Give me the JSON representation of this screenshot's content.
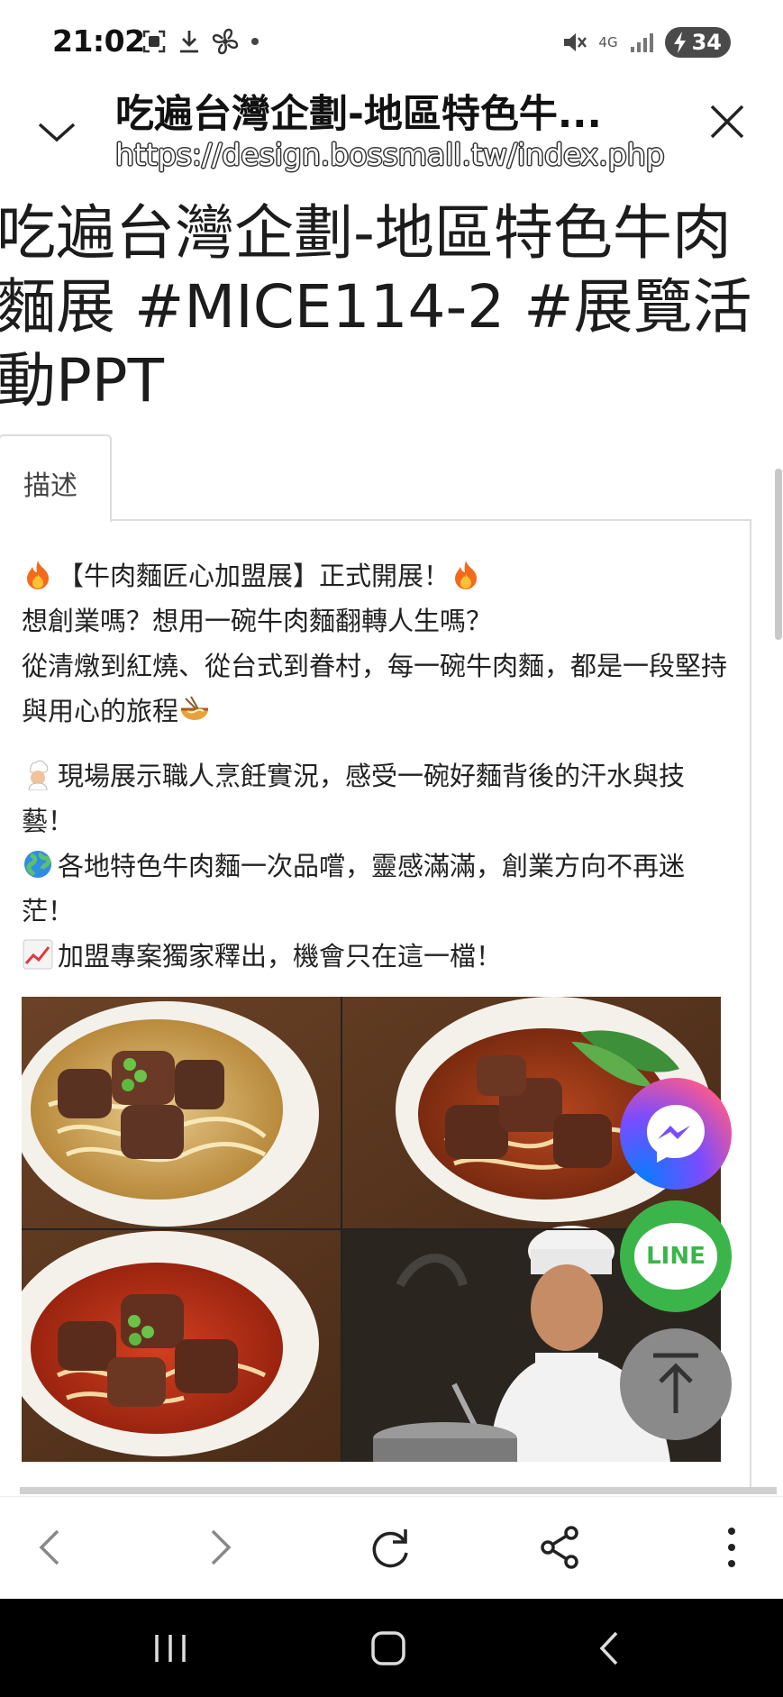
{
  "status_bar": {
    "time": "21:02",
    "network": "4G",
    "battery": "34"
  },
  "header": {
    "title": "吃遍台灣企劃-地區特色牛...",
    "url": "https://design.bossmall.tw/index.php"
  },
  "page": {
    "title": "吃遍台灣企劃-地區特色牛肉麵展 #MICE114-2 #展覽活動PPT",
    "tab_label": "描述",
    "paragraph1": [
      "【牛肉麵匠心加盟展】正式開展！",
      "想創業嗎？想用一碗牛肉麵翻轉人生嗎？",
      "從清燉到紅燒、從台式到眷村，每一碗牛肉麵，都是一段堅持與用心的旅程"
    ],
    "paragraph2": [
      "現場展示職人烹飪實況，感受一碗好麵背後的汗水與技藝！",
      "各地特色牛肉麵一次品嚐，靈感滿滿，創業方向不再迷茫！",
      "加盟專案獨家釋出，機會只在這一檔！"
    ]
  },
  "floating": {
    "line_label": "LINE"
  },
  "icons": {
    "status": [
      "screenshot-icon",
      "download-icon",
      "fan-icon",
      "dot-icon",
      "mute-icon",
      "signal-icon",
      "battery-icon"
    ],
    "header": [
      "chevron-down-icon",
      "close-icon"
    ],
    "toolbar": [
      "back-icon",
      "forward-icon",
      "reload-icon",
      "share-icon",
      "more-icon"
    ],
    "nav": [
      "recents-icon",
      "home-icon",
      "nav-back-icon"
    ]
  },
  "colors": {
    "line_green": "#3bb54a",
    "scroll_top_gray": "#8a8a8a",
    "border_gray": "#dcdcdc"
  }
}
